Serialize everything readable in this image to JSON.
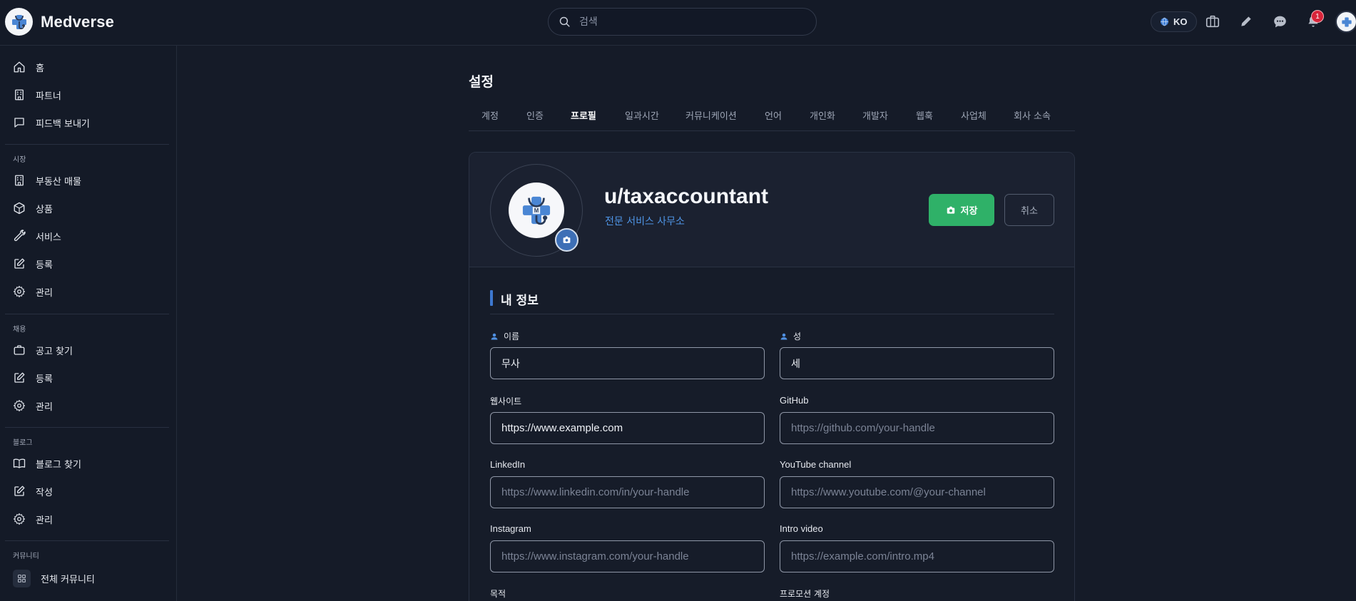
{
  "app": {
    "brand": "Medverse"
  },
  "search": {
    "placeholder": "검색"
  },
  "topbar": {
    "language": "KO",
    "notification_count": "1"
  },
  "sidebar": {
    "top_items": [
      {
        "label": "홈",
        "icon": "home-icon"
      },
      {
        "label": "파트너",
        "icon": "building-icon"
      },
      {
        "label": "피드백 보내기",
        "icon": "message-icon"
      }
    ],
    "sections": [
      {
        "title": "시장",
        "items": [
          {
            "label": "부동산 매물",
            "icon": "building-icon"
          },
          {
            "label": "상품",
            "icon": "box-icon"
          },
          {
            "label": "서비스",
            "icon": "wrench-icon"
          },
          {
            "label": "등록",
            "icon": "edit-icon"
          },
          {
            "label": "관리",
            "icon": "gear-icon"
          }
        ]
      },
      {
        "title": "채용",
        "items": [
          {
            "label": "공고 찾기",
            "icon": "briefcase-icon"
          },
          {
            "label": "등록",
            "icon": "edit-icon"
          },
          {
            "label": "관리",
            "icon": "gear-icon"
          }
        ]
      },
      {
        "title": "블로그",
        "items": [
          {
            "label": "블로그 찾기",
            "icon": "book-icon"
          },
          {
            "label": "작성",
            "icon": "edit-icon"
          },
          {
            "label": "관리",
            "icon": "gear-icon"
          }
        ]
      },
      {
        "title": "커뮤니티",
        "items": [
          {
            "label": "전체 커뮤니티",
            "icon": "grid-icon"
          }
        ]
      }
    ]
  },
  "settings": {
    "title": "설정",
    "tabs": [
      "계정",
      "인증",
      "프로필",
      "일과시간",
      "커뮤니케이션",
      "언어",
      "개인화",
      "개발자",
      "웹훅",
      "사업체",
      "회사 소속"
    ],
    "active_tab": "프로필"
  },
  "profile": {
    "username": "u/taxaccountant",
    "organization": "전문 서비스 사무소",
    "save_label": "저장",
    "cancel_label": "취소",
    "section_title": "내 정보",
    "fields": {
      "first_name": {
        "label": "이름",
        "value": "무사"
      },
      "last_name": {
        "label": "성",
        "value": "세"
      },
      "website": {
        "label": "웹사이트",
        "value": "https://www.example.com"
      },
      "github": {
        "label": "GitHub",
        "placeholder": "https://github.com/your-handle"
      },
      "linkedin": {
        "label": "LinkedIn",
        "placeholder": "https://www.linkedin.com/in/your-handle"
      },
      "youtube": {
        "label": "YouTube channel",
        "placeholder": "https://www.youtube.com/@your-channel"
      },
      "instagram": {
        "label": "Instagram",
        "placeholder": "https://www.instagram.com/your-handle"
      },
      "intro_video": {
        "label": "Intro video",
        "placeholder": "https://example.com/intro.mp4"
      },
      "purpose": {
        "label": "목적"
      },
      "promotion_account": {
        "label": "프로모션 계정"
      }
    }
  },
  "colors": {
    "accent": "#3d78d0",
    "success": "#2fb168",
    "link": "#4f95e6",
    "badge": "#d8243a"
  }
}
